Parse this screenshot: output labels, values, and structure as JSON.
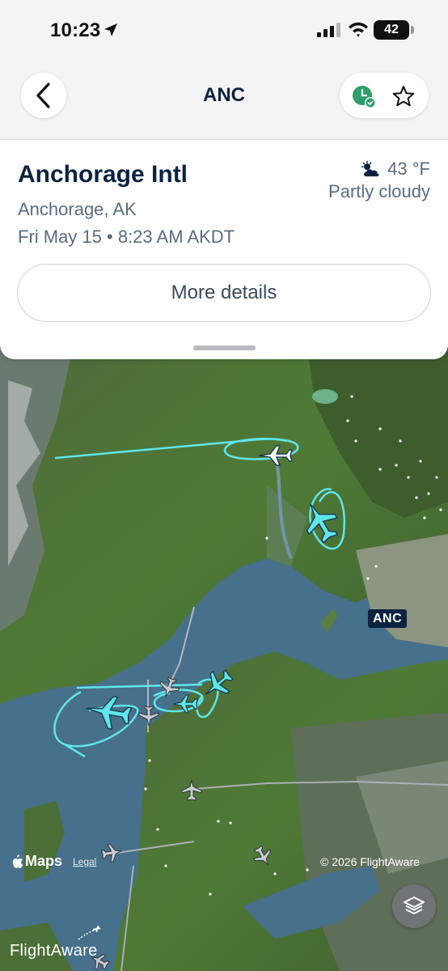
{
  "status_bar": {
    "time": "10:23",
    "battery": "42"
  },
  "nav": {
    "title": "ANC",
    "icons": [
      "chevron-left-icon",
      "history-check-icon",
      "star-icon"
    ]
  },
  "airport": {
    "name": "Anchorage Intl",
    "city": "Anchorage, AK",
    "datetime": "Fri May 15 • 8:23 AM AKDT",
    "weather": {
      "temperature": "43 °F",
      "condition": "Partly cloudy",
      "icon": "partly-cloudy-icon"
    },
    "more_details_label": "More details"
  },
  "map": {
    "airport_marker": "ANC",
    "maps_label": "Maps",
    "legal_label": "Legal",
    "copyright": "© 2026 FlightAware",
    "brand": "FlightAware",
    "track_color": "#5fe6e9",
    "aircraft_colors": {
      "tracked": "#5fe6e9",
      "other": "#c9cdd2"
    }
  }
}
